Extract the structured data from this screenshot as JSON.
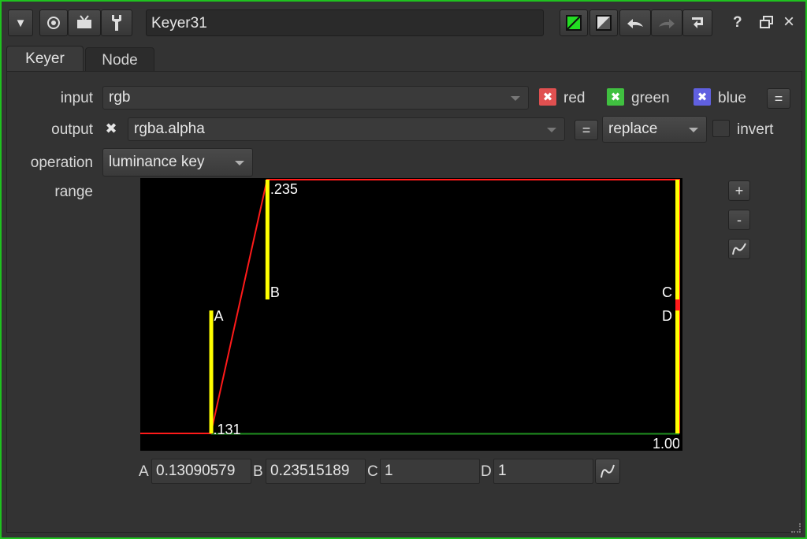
{
  "window": {
    "node_name": "Keyer31",
    "tabs": [
      "Keyer",
      "Node"
    ]
  },
  "icons": {
    "collapse": "triangle-down-icon",
    "viewer": "circle-dot-icon",
    "tv": "tv-icon",
    "wrench": "wrench-icon",
    "undo": "undo-icon",
    "redo": "redo-icon",
    "revert": "revert-icon",
    "help": "?",
    "float": "float-window-icon",
    "close": "×"
  },
  "toolbar": {
    "help_label": "?",
    "close_label": "×"
  },
  "params": {
    "input": {
      "label": "input",
      "value": "rgb",
      "channels": [
        {
          "name": "red",
          "color": "#e05050"
        },
        {
          "name": "green",
          "color": "#40c040"
        },
        {
          "name": "blue",
          "color": "#6060e0"
        }
      ],
      "link_label": "="
    },
    "output": {
      "label": "output",
      "value": "rgba.alpha",
      "link_label": "=",
      "merge_value": "replace",
      "invert_label": "invert"
    },
    "operation": {
      "label": "operation",
      "value": "luminance key"
    },
    "range": {
      "label": "range",
      "side_buttons": [
        "+",
        "-"
      ]
    }
  },
  "chart_data": {
    "type": "line",
    "x": [
      0,
      0.13090579,
      0.23515189,
      1,
      1
    ],
    "y": [
      0,
      0,
      1,
      1,
      0
    ],
    "xlim": [
      0,
      1
    ],
    "ylim": [
      0,
      1
    ],
    "markers": [
      {
        "name": "A",
        "value": 0.13090579,
        "tick_label": ".131"
      },
      {
        "name": "B",
        "value": 0.23515189,
        "tick_label": ".235"
      },
      {
        "name": "C",
        "value": 1
      },
      {
        "name": "D",
        "value": 1,
        "tick_label": "1.00"
      }
    ],
    "colors": {
      "curve": "#ff1a1a",
      "marker": "#ffff00",
      "baseline": "#1f8f1f"
    }
  },
  "range_fields": [
    {
      "label": "A",
      "value": "0.13090579"
    },
    {
      "label": "B",
      "value": "0.23515189"
    },
    {
      "label": "C",
      "value": "1"
    },
    {
      "label": "D",
      "value": "1"
    }
  ]
}
